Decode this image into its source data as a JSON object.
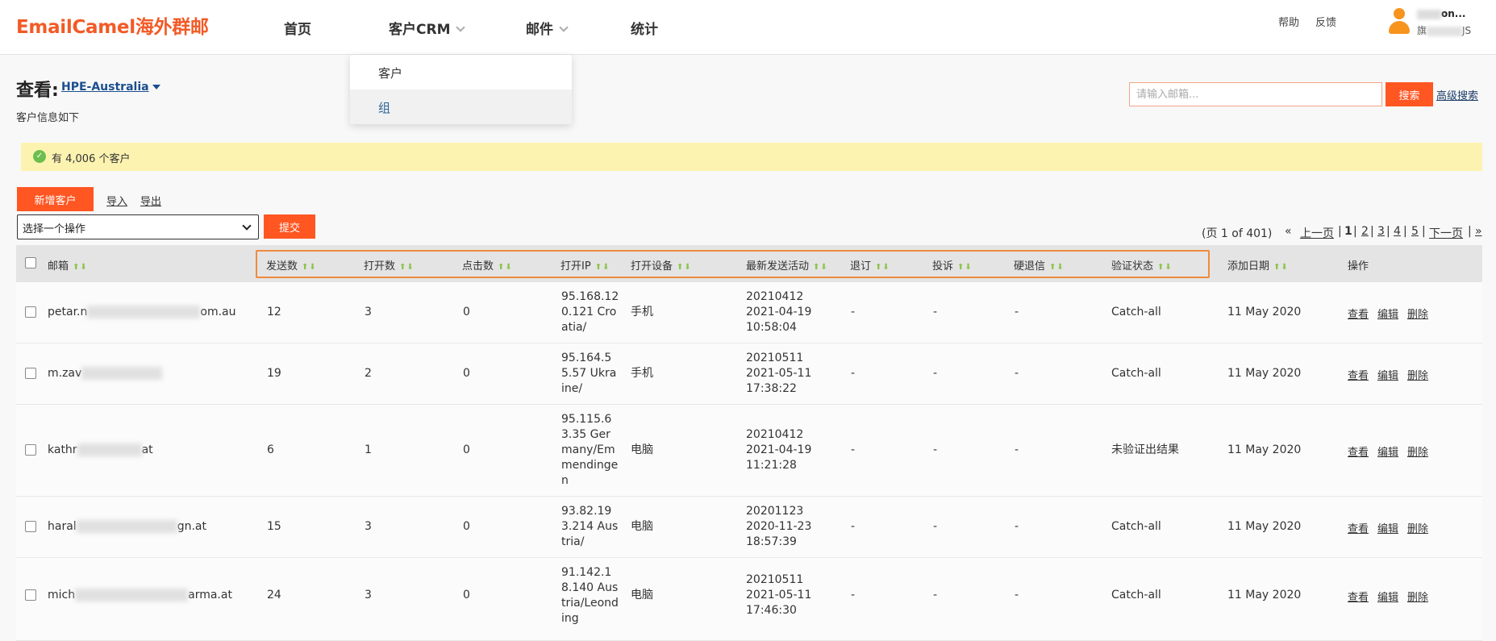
{
  "header": {
    "logo": "EmailCamel海外群邮",
    "nav": [
      {
        "label": "首页"
      },
      {
        "label": "客户CRM"
      },
      {
        "label": "邮件"
      },
      {
        "label": "统计"
      }
    ],
    "help": "帮助",
    "feedback": "反馈",
    "user_name": "on...",
    "user_plan": "旗",
    "user_plan_suffix": "JS"
  },
  "dropdown": {
    "items": [
      "客户",
      "组"
    ]
  },
  "page": {
    "view_label": "查看:",
    "group_name": "HPE-Australia",
    "subtitle": "客户信息如下",
    "search_placeholder": "请输入邮箱...",
    "search_button": "搜索",
    "advanced_search": "高级搜索",
    "notice": "有 4,006 个客户"
  },
  "toolbar": {
    "add_button": "新增客户",
    "import": "导入",
    "export": "导出",
    "select_placeholder": "选择一个操作",
    "submit": "提交"
  },
  "pagination": {
    "info": "(页 1 of 401)",
    "first": "«",
    "prev": "上一页",
    "current": "1",
    "pages": [
      "2",
      "3",
      "4",
      "5"
    ],
    "next": "下一页",
    "last": "»",
    "sep": "|"
  },
  "table": {
    "headers": [
      "邮箱",
      "发送数",
      "打开数",
      "点击数",
      "打开IP",
      "打开设备",
      "最新发送活动",
      "退订",
      "投诉",
      "硬退信",
      "验证状态",
      "添加日期",
      "操作"
    ],
    "actions": {
      "view": "查看",
      "edit": "编辑",
      "delete": "删除"
    },
    "rows": [
      {
        "email_start": "petar.n",
        "email_end": "om.au",
        "sent": "12",
        "opens": "3",
        "clicks": "0",
        "ip": "95.168.120.121 Croatia/",
        "device": "手机",
        "last_date": "20210412",
        "last_time": "2021-04-19 10:58:04",
        "unsub": "-",
        "complaint": "-",
        "bounce": "-",
        "verify": "Catch-all",
        "added": "11 May 2020"
      },
      {
        "email_start": "m.zav",
        "email_end": "",
        "sent": "19",
        "opens": "2",
        "clicks": "0",
        "ip": "95.164.55.57 Ukraine/",
        "device": "手机",
        "last_date": "20210511",
        "last_time": "2021-05-11 17:38:22",
        "unsub": "-",
        "complaint": "-",
        "bounce": "-",
        "verify": "Catch-all",
        "added": "11 May 2020"
      },
      {
        "email_start": "kathr",
        "email_end": "at",
        "sent": "6",
        "opens": "1",
        "clicks": "0",
        "ip": "95.115.63.35 Germany/Emmendingen",
        "device": "电脑",
        "last_date": "20210412",
        "last_time": "2021-04-19 11:21:28",
        "unsub": "-",
        "complaint": "-",
        "bounce": "-",
        "verify": "未验证出结果",
        "added": "11 May 2020"
      },
      {
        "email_start": "haral",
        "email_end": "gn.at",
        "sent": "15",
        "opens": "3",
        "clicks": "0",
        "ip": "93.82.193.214 Austria/",
        "device": "电脑",
        "last_date": "20201123",
        "last_time": "2020-11-23 18:57:39",
        "unsub": "-",
        "complaint": "-",
        "bounce": "-",
        "verify": "Catch-all",
        "added": "11 May 2020"
      },
      {
        "email_start": "mich",
        "email_end": "arma.at",
        "sent": "24",
        "opens": "3",
        "clicks": "0",
        "ip": "91.142.18.140 Austria/Leonding",
        "device": "电脑",
        "last_date": "20210511",
        "last_time": "2021-05-11 17:46:30",
        "unsub": "-",
        "complaint": "-",
        "bounce": "-",
        "verify": "Catch-all",
        "added": "11 May 2020"
      }
    ]
  }
}
